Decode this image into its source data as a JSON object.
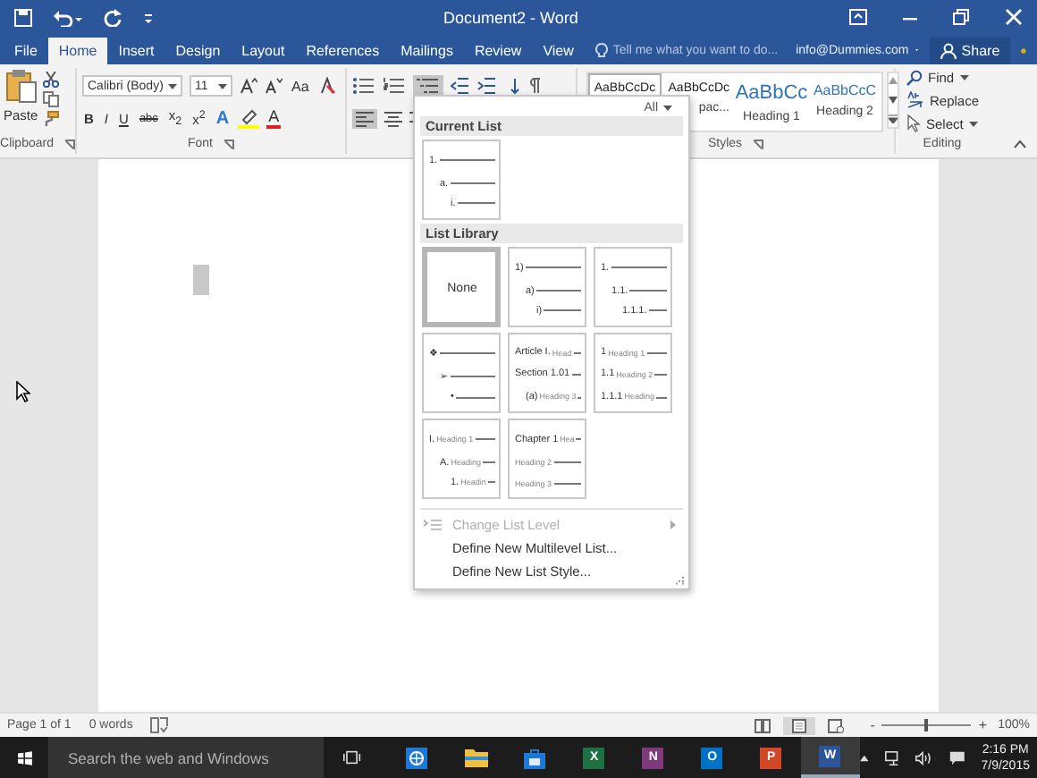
{
  "title_bar": {
    "title": "Document2 - Word"
  },
  "ribbon_tabs": [
    {
      "label": "File",
      "selected": false
    },
    {
      "label": "Home",
      "selected": true
    },
    {
      "label": "Insert",
      "selected": false
    },
    {
      "label": "Design",
      "selected": false
    },
    {
      "label": "Layout",
      "selected": false
    },
    {
      "label": "References",
      "selected": false
    },
    {
      "label": "Mailings",
      "selected": false
    },
    {
      "label": "Review",
      "selected": false
    },
    {
      "label": "View",
      "selected": false
    }
  ],
  "tell_me": {
    "placeholder": "Tell me what you want to do..."
  },
  "account": "info@Dummies.com",
  "share": "Share",
  "clipboard": {
    "paste": "Paste",
    "label": "Clipboard"
  },
  "font": {
    "name": "Calibri (Body)",
    "size": "11",
    "change_case": "Aa",
    "format_buttons": [
      "B",
      "I",
      "U",
      "abc",
      "x$_{2}$",
      "x$^{2}$"
    ],
    "text_effects": "A",
    "font_color": "A",
    "label": "Font"
  },
  "paragraph": {
    "multilevel_selected": true,
    "align_left_selected": true
  },
  "styles": {
    "items": [
      {
        "preview": "AaBbCcDc",
        "kind": "body",
        "selected": true
      },
      {
        "preview": "AaBbCcDc",
        "label": "pac...",
        "kind": "body",
        "selected": false
      },
      {
        "preview": "AaBbCc",
        "label": "Heading 1",
        "kind": "heading",
        "selected": false
      },
      {
        "preview": "AaBbCcC",
        "label": "Heading 2",
        "kind": "heading",
        "selected": false
      }
    ],
    "label": "Styles"
  },
  "editing": {
    "find": "Find",
    "replace": "Replace",
    "select": "Select",
    "label": "Editing"
  },
  "multilevel_menu": {
    "filter": "All",
    "current_heading": "Current List",
    "current": [
      {
        "marker": "1.",
        "children": [
          {
            "marker": "a.",
            "children": [
              {
                "marker": "i."
              }
            ]
          }
        ]
      }
    ],
    "library_heading": "List Library",
    "library": [
      {
        "kind": "none",
        "label": "None",
        "selected": true
      },
      {
        "kind": "lines",
        "selected": false,
        "lines": [
          {
            "marker": "1)",
            "children": [
              {
                "marker": "a)",
                "children": [
                  {
                    "marker": "i)"
                  }
                ]
              }
            ]
          }
        ]
      },
      {
        "kind": "lines",
        "selected": false,
        "lines": [
          {
            "marker": "1.",
            "children": [
              {
                "marker": "1.1.",
                "children": [
                  {
                    "marker": "1.1.1."
                  }
                ]
              }
            ]
          }
        ]
      },
      {
        "kind": "lines",
        "selected": false,
        "lines": [
          {
            "marker": "❖",
            "children": [
              {
                "marker": "➢",
                "children": [
                  {
                    "marker": "•"
                  }
                ]
              }
            ]
          }
        ]
      },
      {
        "kind": "lines",
        "selected": false,
        "lines": [
          {
            "marker": "Article I.",
            "text": "Head"
          },
          {
            "marker": "Section 1.01",
            "children": [
              {
                "marker": "(a)",
                "text": "Heading 3"
              }
            ]
          }
        ]
      },
      {
        "kind": "lines",
        "selected": false,
        "lines": [
          {
            "marker": "1",
            "text": "Heading 1"
          },
          {
            "marker": "1.1",
            "text": "Heading 2"
          },
          {
            "marker": "1.1.1",
            "text": "Heading"
          }
        ]
      },
      {
        "kind": "lines",
        "selected": false,
        "lines": [
          {
            "marker": "I.",
            "text": "Heading 1",
            "children": [
              {
                "marker": "A.",
                "text": "Heading",
                "children": [
                  {
                    "marker": "1.",
                    "text": "Headin"
                  }
                ]
              }
            ]
          }
        ]
      },
      {
        "kind": "lines",
        "selected": false,
        "lines": [
          {
            "marker": "Chapter 1",
            "text": "Hea"
          },
          {
            "text": "Heading 2"
          },
          {
            "text": "Heading 3"
          }
        ]
      }
    ],
    "actions": [
      {
        "label": "Change List Level",
        "disabled": true,
        "kind": "submenu"
      },
      {
        "label": "Define New Multilevel List...",
        "disabled": false,
        "kind": "command"
      },
      {
        "label": "Define New List Style...",
        "disabled": false,
        "kind": "command"
      }
    ]
  },
  "status_bar": {
    "page": "Page 1 of 1",
    "words": "0 words",
    "views": [
      {
        "kind": "read",
        "selected": false
      },
      {
        "kind": "print",
        "selected": true
      },
      {
        "kind": "web",
        "selected": false
      }
    ],
    "zoom_out": "-",
    "zoom_in": "+",
    "zoom": {
      "level": 0.5
    },
    "zoom_percent": "100%"
  },
  "taskbar": {
    "search_placeholder": "Search the web and Windows",
    "apps": [
      {
        "kind": "globe",
        "color": "#1e78d7",
        "active": false
      },
      {
        "kind": "folder",
        "color": "#f0c040",
        "active": false
      },
      {
        "kind": "bag",
        "color": "#1e78d7",
        "active": false
      },
      {
        "kind": "letter",
        "letter": "X",
        "color": "#1e7145",
        "active": false
      },
      {
        "kind": "letter",
        "letter": "N",
        "color": "#80397b",
        "active": false
      },
      {
        "kind": "letter",
        "letter": "O",
        "color": "#0072c6",
        "active": false
      },
      {
        "kind": "letter",
        "letter": "P",
        "color": "#d24726",
        "active": false
      },
      {
        "kind": "letter",
        "letter": "W",
        "color": "#2b579a",
        "active": true
      }
    ],
    "time": "2:16 PM",
    "date": "7/9/2015"
  }
}
